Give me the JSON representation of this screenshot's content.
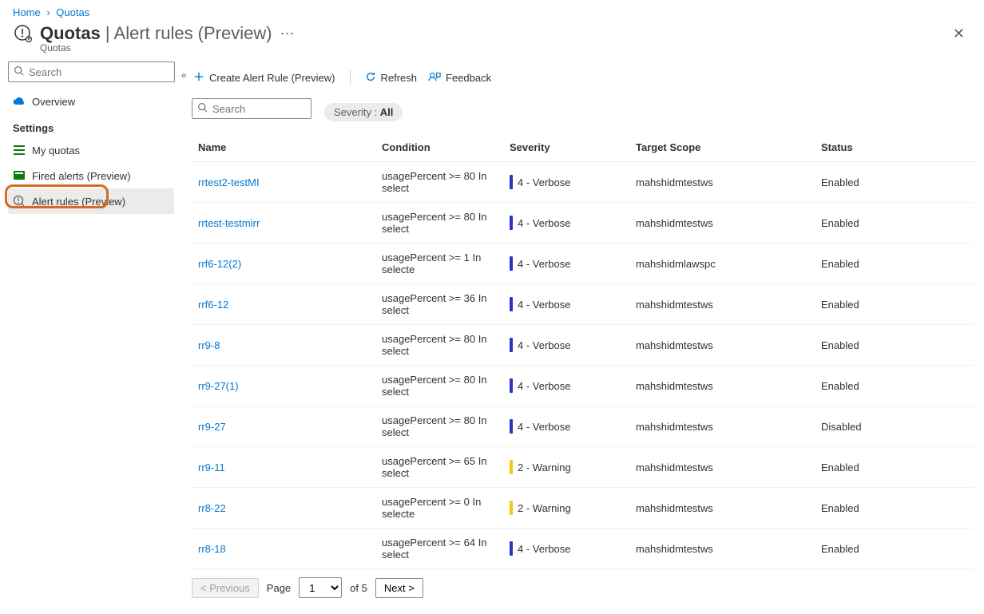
{
  "breadcrumbs": {
    "home": "Home",
    "quotas": "Quotas"
  },
  "header": {
    "title_strong": "Quotas",
    "title_sep": " | ",
    "title_light": "Alert rules (Preview)",
    "subtitle": "Quotas"
  },
  "sidebar": {
    "search_placeholder": "Search",
    "overview": "Overview",
    "settings_label": "Settings",
    "items": [
      {
        "label": "My quotas",
        "icon": "list-icon",
        "color": "#107c10"
      },
      {
        "label": "Fired alerts (Preview)",
        "icon": "book-icon",
        "color": "#107c10"
      },
      {
        "label": "Alert rules (Preview)",
        "icon": "rules-icon",
        "color": "#605e5c",
        "active": true
      }
    ]
  },
  "toolbar": {
    "create": "Create Alert Rule (Preview)",
    "refresh": "Refresh",
    "feedback": "Feedback"
  },
  "filters": {
    "search_placeholder": "Search",
    "severity_label": "Severity : ",
    "severity_value": "All"
  },
  "columns": {
    "name": "Name",
    "condition": "Condition",
    "severity": "Severity",
    "scope": "Target Scope",
    "status": "Status"
  },
  "rows": [
    {
      "name": "rrtest2-testMI",
      "condition": "usagePercent >= 80 In select",
      "severity": "4 - Verbose",
      "sev_class": "sev-verbose",
      "scope": "mahshidmtestws",
      "status": "Enabled"
    },
    {
      "name": "rrtest-testmirr",
      "condition": "usagePercent >= 80 In select",
      "severity": "4 - Verbose",
      "sev_class": "sev-verbose",
      "scope": "mahshidmtestws",
      "status": "Enabled"
    },
    {
      "name": "rrf6-12(2)",
      "condition": "usagePercent >= 1 In selecte",
      "severity": "4 - Verbose",
      "sev_class": "sev-verbose",
      "scope": "mahshidmlawspc",
      "status": "Enabled"
    },
    {
      "name": "rrf6-12",
      "condition": "usagePercent >= 36 In select",
      "severity": "4 - Verbose",
      "sev_class": "sev-verbose",
      "scope": "mahshidmtestws",
      "status": "Enabled"
    },
    {
      "name": "rr9-8",
      "condition": "usagePercent >= 80 In select",
      "severity": "4 - Verbose",
      "sev_class": "sev-verbose",
      "scope": "mahshidmtestws",
      "status": "Enabled"
    },
    {
      "name": "rr9-27(1)",
      "condition": "usagePercent >= 80 In select",
      "severity": "4 - Verbose",
      "sev_class": "sev-verbose",
      "scope": "mahshidmtestws",
      "status": "Enabled"
    },
    {
      "name": "rr9-27",
      "condition": "usagePercent >= 80 In select",
      "severity": "4 - Verbose",
      "sev_class": "sev-verbose",
      "scope": "mahshidmtestws",
      "status": "Disabled"
    },
    {
      "name": "rr9-11",
      "condition": "usagePercent >= 65 In select",
      "severity": "2 - Warning",
      "sev_class": "sev-warning",
      "scope": "mahshidmtestws",
      "status": "Enabled"
    },
    {
      "name": "rr8-22",
      "condition": "usagePercent >= 0 In selecte",
      "severity": "2 - Warning",
      "sev_class": "sev-warning",
      "scope": "mahshidmtestws",
      "status": "Enabled"
    },
    {
      "name": "rr8-18",
      "condition": "usagePercent >= 64 In select",
      "severity": "4 - Verbose",
      "sev_class": "sev-verbose",
      "scope": "mahshidmtestws",
      "status": "Enabled"
    }
  ],
  "pager": {
    "prev": "< Previous",
    "page_label": "Page",
    "page_current": "1",
    "of_total": "of 5",
    "next": "Next >"
  }
}
